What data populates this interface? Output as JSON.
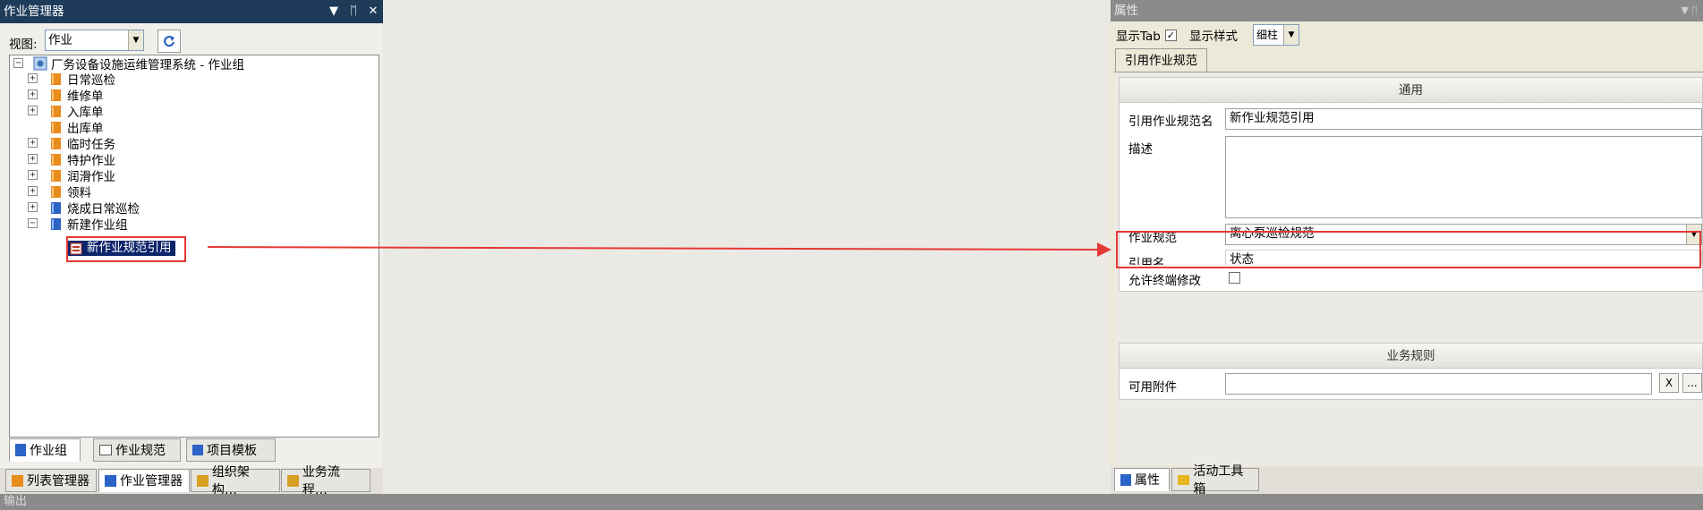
{
  "left_panel": {
    "title": "作业管理器",
    "title_icons": [
      "▼",
      "ᛖ",
      "✕"
    ],
    "view_label": "视图:",
    "view_value": "作业",
    "tree": {
      "root": "厂务设备设施运维管理系统 - 作业组",
      "items": [
        {
          "label": "日常巡检",
          "expand": "+"
        },
        {
          "label": "维修单",
          "expand": "+"
        },
        {
          "label": "入库单",
          "expand": "+"
        },
        {
          "label": "出库单",
          "expand": ""
        },
        {
          "label": "临时任务",
          "expand": "+"
        },
        {
          "label": "特护作业",
          "expand": "+"
        },
        {
          "label": "润滑作业",
          "expand": "+"
        },
        {
          "label": "领料",
          "expand": "+"
        },
        {
          "label": "烧成日常巡检",
          "expand": "+"
        },
        {
          "label": "新建作业组",
          "expand": "−"
        }
      ],
      "selected_child": "新作业规范引用"
    },
    "tabs_row1": [
      "作业组",
      "作业规范",
      "项目模板"
    ],
    "tabs_row2": [
      "列表管理器",
      "作业管理器",
      "组织架构…",
      "业务流程…"
    ]
  },
  "right_panel": {
    "title": "属性",
    "title_icons": "▼ ᛖ",
    "show_tab_label": "显示Tab",
    "show_tab_checked": "✓",
    "show_style_label": "显示样式",
    "show_style_value": "细柱",
    "tab": "引用作业规范",
    "section_general": "通用",
    "fields": {
      "ref_name_label": "引用作业规范名",
      "ref_name_value": "新作业规范引用",
      "desc_label": "描述",
      "desc_value": "",
      "spec_label": "作业规范",
      "spec_value": "离心泵巡检规范",
      "ref_label": "引用名",
      "ref_value": "状态",
      "allow_label": "允许终端修改"
    },
    "section_rules": "业务规则",
    "attach_label": "可用附件",
    "attach_value": "",
    "clear_btn": "X",
    "more_btn": "...",
    "bottom_tabs": [
      "属性",
      "活动工具箱"
    ]
  },
  "output_bar": "输出",
  "colors": {
    "highlight": "#e53935",
    "titlebar": "#1e3c5a",
    "selection": "#0b246a"
  }
}
